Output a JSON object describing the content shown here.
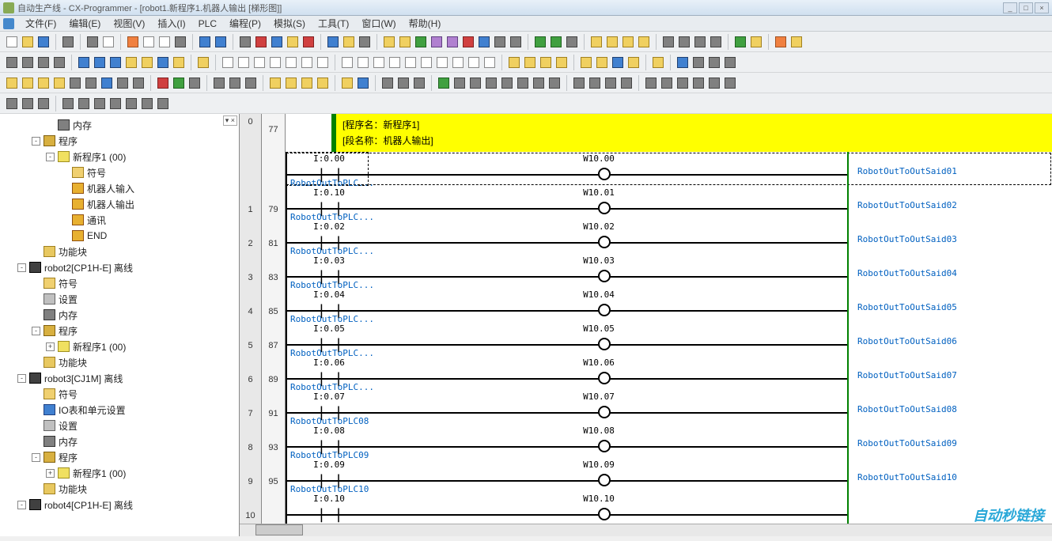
{
  "title": "自动生产线 - CX-Programmer - [robot1.新程序1.机器人输出 [梯形图]]",
  "win_controls": {
    "min": "_",
    "max": "□",
    "close": "×"
  },
  "menu": [
    "文件(F)",
    "编辑(E)",
    "视图(V)",
    "插入(I)",
    "PLC",
    "编程(P)",
    "模拟(S)",
    "工具(T)",
    "窗口(W)",
    "帮助(H)"
  ],
  "tree_close": "▾ ×",
  "tree": [
    {
      "depth": 3,
      "exp": "",
      "icon": "ic-mem",
      "label": "内存"
    },
    {
      "depth": 2,
      "exp": "-",
      "icon": "ic-prog",
      "label": "程序"
    },
    {
      "depth": 3,
      "exp": "-",
      "icon": "ic-star",
      "label": "新程序1 (00)"
    },
    {
      "depth": 4,
      "exp": "",
      "icon": "ic-sym",
      "label": "符号"
    },
    {
      "depth": 4,
      "exp": "",
      "icon": "ic-sect",
      "label": "机器人输入"
    },
    {
      "depth": 4,
      "exp": "",
      "icon": "ic-sect",
      "label": "机器人输出"
    },
    {
      "depth": 4,
      "exp": "",
      "icon": "ic-sect",
      "label": "通讯"
    },
    {
      "depth": 4,
      "exp": "",
      "icon": "ic-sect",
      "label": "END"
    },
    {
      "depth": 2,
      "exp": "",
      "icon": "ic-folder",
      "label": "功能块"
    },
    {
      "depth": 1,
      "exp": "-",
      "icon": "ic-plc",
      "label": "robot2[CP1H-E] 离线"
    },
    {
      "depth": 2,
      "exp": "",
      "icon": "ic-sym",
      "label": "符号"
    },
    {
      "depth": 2,
      "exp": "",
      "icon": "ic-set",
      "label": "设置"
    },
    {
      "depth": 2,
      "exp": "",
      "icon": "ic-mem",
      "label": "内存"
    },
    {
      "depth": 2,
      "exp": "-",
      "icon": "ic-prog",
      "label": "程序"
    },
    {
      "depth": 3,
      "exp": "+",
      "icon": "ic-star",
      "label": "新程序1 (00)"
    },
    {
      "depth": 2,
      "exp": "",
      "icon": "ic-folder",
      "label": "功能块"
    },
    {
      "depth": 1,
      "exp": "-",
      "icon": "ic-plc",
      "label": "robot3[CJ1M] 离线"
    },
    {
      "depth": 2,
      "exp": "",
      "icon": "ic-sym",
      "label": "符号"
    },
    {
      "depth": 2,
      "exp": "",
      "icon": "ic-io",
      "label": "IO表和单元设置"
    },
    {
      "depth": 2,
      "exp": "",
      "icon": "ic-set",
      "label": "设置"
    },
    {
      "depth": 2,
      "exp": "",
      "icon": "ic-mem",
      "label": "内存"
    },
    {
      "depth": 2,
      "exp": "-",
      "icon": "ic-prog",
      "label": "程序"
    },
    {
      "depth": 3,
      "exp": "+",
      "icon": "ic-star",
      "label": "新程序1 (00)"
    },
    {
      "depth": 2,
      "exp": "",
      "icon": "ic-folder",
      "label": "功能块"
    },
    {
      "depth": 1,
      "exp": "-",
      "icon": "ic-plc",
      "label": "robot4[CP1H-E] 离线"
    }
  ],
  "header": {
    "prog": "[程序名：新程序1]",
    "section": "[段名称：机器人输出]"
  },
  "header_rung_left": "0",
  "header_rung_num": "77",
  "rungs": [
    {
      "idx": "",
      "num": "",
      "in": "I:0.00",
      "desc": "RobotOutToPLC...",
      "out": "W10.00",
      "outdesc": "RobotOutToOutSaid01",
      "sel": true
    },
    {
      "idx": "1",
      "num": "79",
      "in": "I:0.10",
      "desc": "RobotOutToPLC...",
      "out": "W10.01",
      "outdesc": "RobotOutToOutSaid02"
    },
    {
      "idx": "2",
      "num": "81",
      "in": "I:0.02",
      "desc": "RobotOutToPLC...",
      "out": "W10.02",
      "outdesc": "RobotOutToOutSaid03"
    },
    {
      "idx": "3",
      "num": "83",
      "in": "I:0.03",
      "desc": "RobotOutToPLC...",
      "out": "W10.03",
      "outdesc": "RobotOutToOutSaid04"
    },
    {
      "idx": "4",
      "num": "85",
      "in": "I:0.04",
      "desc": "RobotOutToPLC...",
      "out": "W10.04",
      "outdesc": "RobotOutToOutSaid05"
    },
    {
      "idx": "5",
      "num": "87",
      "in": "I:0.05",
      "desc": "RobotOutToPLC...",
      "out": "W10.05",
      "outdesc": "RobotOutToOutSaid06"
    },
    {
      "idx": "6",
      "num": "89",
      "in": "I:0.06",
      "desc": "RobotOutToPLC...",
      "out": "W10.06",
      "outdesc": "RobotOutToOutSaid07"
    },
    {
      "idx": "7",
      "num": "91",
      "in": "I:0.07",
      "desc": "RobotOutToPLC08",
      "out": "W10.07",
      "outdesc": "RobotOutToOutSaid08"
    },
    {
      "idx": "8",
      "num": "93",
      "in": "I:0.08",
      "desc": "RobotOutToPLC09",
      "out": "W10.08",
      "outdesc": "RobotOutToOutSaid09"
    },
    {
      "idx": "9",
      "num": "95",
      "in": "I:0.09",
      "desc": "RobotOutToPLC10",
      "out": "W10.09",
      "outdesc": "RobotOutToOutSaid10"
    },
    {
      "idx": "10",
      "num": "",
      "in": "I:0.10",
      "desc": "",
      "out": "W10.10",
      "outdesc": ""
    }
  ],
  "watermark": "自动秒链接"
}
